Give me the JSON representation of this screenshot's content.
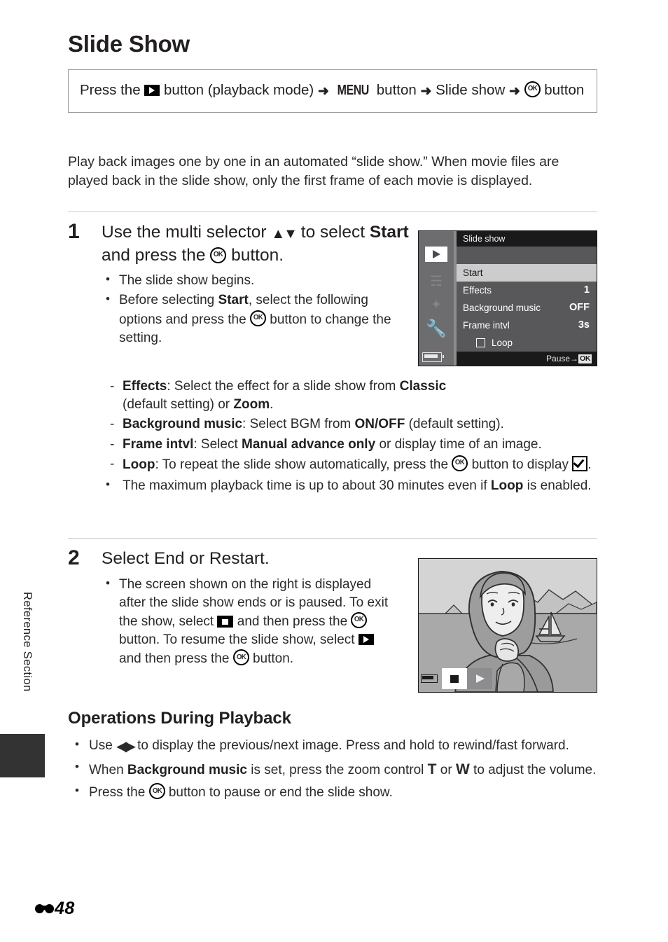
{
  "sidebar": {
    "section_label": "Reference Section"
  },
  "page": {
    "title": "Slide Show",
    "nav_path": {
      "prefix": "Press the",
      "playback_icon": "playback-button-icon",
      "mid1": "button (playback mode)",
      "arrow": "➜",
      "menu_label": "MENU",
      "mid2": "button",
      "slide_show": "Slide show",
      "ok_icon": "OK",
      "suffix": "button"
    },
    "intro": "Play back images one by one in an automated “slide show.” When movie files are played back in the slide show, only the first frame of each movie is displayed."
  },
  "step1": {
    "number": "1",
    "head_a": "Use the multi selector",
    "head_updown": "▲▼",
    "head_b": "to",
    "head_c": "select",
    "head_start": "Start",
    "head_d": "and press the",
    "head_ok": "OK",
    "head_e": "button.",
    "bullets": {
      "b1": "The slide show begins.",
      "b2_a": "Before selecting",
      "b2_start": "Start",
      "b2_b": ", select the following options and press the",
      "b2_ok": "OK",
      "b2_c": "button to change the setting.",
      "d1_term": "Effects",
      "d1_a": ": Select the effect for a slide show from",
      "d1_classic": "Classic",
      "d1_b": "(default setting) or",
      "d1_zoom": "Zoom",
      "d1_c": ".",
      "d2_term": "Background music",
      "d2_a": ": Select BGM from",
      "d2_onoff": "ON/OFF",
      "d2_b": "(default setting).",
      "d3_term": "Frame intvl",
      "d3_a": ": Select",
      "d3_manual": "Manual advance only",
      "d3_b": "or display time of an image.",
      "d4_term": "Loop",
      "d4_a": ": To repeat the slide show automatically, press the",
      "d4_ok": "OK",
      "d4_b": "button to display",
      "d4_c": ".",
      "b3_a": "The maximum playback time is up to about 30 minutes even if",
      "b3_loop": "Loop",
      "b3_b": "is enabled."
    }
  },
  "camera_menu": {
    "title": "Slide show",
    "icons": {
      "playback": "playback-icon",
      "wifi": "wifi-icon",
      "gps": "gps-icon",
      "setup": "wrench-setup-icon",
      "battery": "battery-icon"
    },
    "rows": [
      {
        "label": "Start",
        "value": "",
        "selected": true
      },
      {
        "label": "Effects",
        "value": "1",
        "selected": false
      },
      {
        "label": "Background music",
        "value": "OFF",
        "selected": false
      },
      {
        "label": "Frame intvl",
        "value": "3s",
        "selected": false
      }
    ],
    "loop_label": "Loop",
    "loop_checked": false,
    "footer_text": "Pause",
    "footer_arrow": "→",
    "footer_ok": "OK"
  },
  "step2": {
    "number": "2",
    "head": "Select End or Restart.",
    "bullet_a": "The screen shown on the right is displayed after the slide show ends or is paused. To exit the show, select",
    "bullet_stop_icon": "stop-button-icon",
    "bullet_b": "and then press the",
    "bullet_ok1": "OK",
    "bullet_c": "button. To resume the slide show, select",
    "bullet_play_icon": "play-button-icon",
    "bullet_d": "and then press the",
    "bullet_ok2": "OK",
    "bullet_e": "button."
  },
  "camera_photo": {
    "description": "slide-show-playback-photo",
    "controls": {
      "battery": "battery-icon",
      "stop": "stop-button",
      "play": "play-button"
    }
  },
  "operations": {
    "heading": "Operations During Playback",
    "b1_a": "Use",
    "b1_lr": "◀▶",
    "b1_b": "to display the previous/next image. Press and hold to rewind/fast forward.",
    "b2_a": "When",
    "b2_bgm": "Background music",
    "b2_b": "is set, press the zoom control",
    "b2_t": "T",
    "b2_or": "or",
    "b2_w": "W",
    "b2_c": "to adjust the volume.",
    "b3_a": "Press the",
    "b3_ok": "OK",
    "b3_b": "button to pause or end the slide show."
  },
  "footer": {
    "page_number": "48",
    "mark": "reference-section-mark"
  },
  "colors": {
    "text": "#231f20",
    "rule": "#c9c9c9",
    "menu_bg": "#58585a",
    "menu_titlebar": "#1a1a1a",
    "menu_selected": "#cccccc",
    "side_tab": "#333333"
  }
}
